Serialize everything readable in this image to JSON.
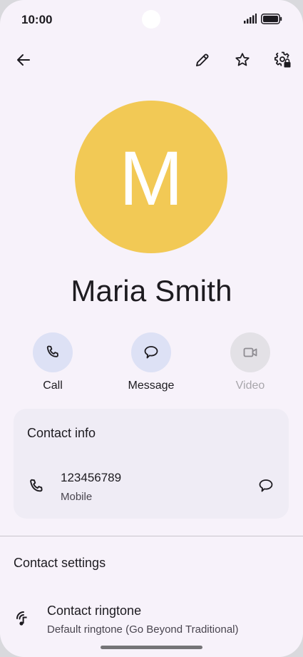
{
  "status_bar": {
    "time": "10:00"
  },
  "contact": {
    "avatar_letter": "M",
    "name": "Maria Smith",
    "avatar_color": "#f2c955"
  },
  "actions": {
    "call_label": "Call",
    "message_label": "Message",
    "video_label": "Video"
  },
  "contact_info": {
    "title": "Contact info",
    "phone_number": "123456789",
    "phone_type": "Mobile"
  },
  "contact_settings": {
    "title": "Contact settings",
    "ringtone_title": "Contact ringtone",
    "ringtone_value": "Default ringtone (Go Beyond Traditional)"
  },
  "icons": {
    "back": "arrow-left-icon",
    "edit": "pencil-icon",
    "favorite": "star-outline-icon",
    "settings": "gear-lock-icon",
    "call": "phone-icon",
    "message": "chat-bubble-icon",
    "video": "videocam-icon",
    "ringtone": "ringtone-icon"
  },
  "colors": {
    "background": "#f7f2fa",
    "action_circle": "#dde1f5",
    "card": "#efecf5"
  }
}
